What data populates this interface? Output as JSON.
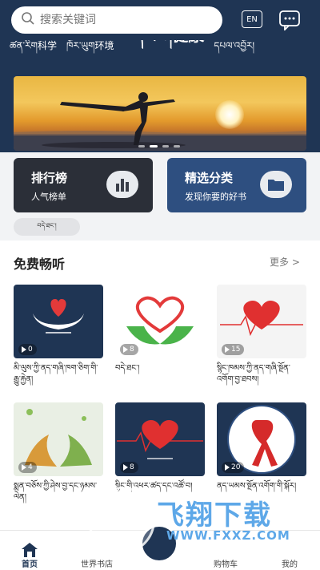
{
  "search": {
    "placeholder": "搜索关键词"
  },
  "header": {
    "lang_label": "EN"
  },
  "tabs": [
    {
      "label": "ཚན་རིག科学"
    },
    {
      "label": "ཁོར་ཡུག环境"
    },
    {
      "label": "བདེ་ཐང་།健康"
    },
    {
      "label": "དཔལ་འབྱོར།"
    }
  ],
  "cards": {
    "rank": {
      "title": "排行榜",
      "subtitle": "人气榜单"
    },
    "category": {
      "title": "精选分类",
      "subtitle": "发现你要的好书"
    }
  },
  "chip": {
    "label": "བདེ་ཐང་།"
  },
  "free_listen": {
    "title": "免费畅听",
    "more": "更多 >",
    "items": [
      {
        "count": "0",
        "caption": "མི་ལུས་ཀྱི་ནད་གཞི་ཁག་ཅིག་གི་རྒྱུ་རྐྱེན།"
      },
      {
        "count": "8",
        "caption": "བདེ་ཐང་།"
      },
      {
        "count": "15",
        "caption": "སྙིང་ཁམས་ཀྱི་ནད་གཞི་སྔོན་འགོག་བྱ་ཐབས།"
      },
      {
        "count": "4",
        "caption": "སྨན་བཅོས་ཀྱི་ཤེས་བྱ་དང་ཉམས་ལེན།"
      },
      {
        "count": "8",
        "caption": "སྙིང་གི་འཕར་ཚད་དང་འཚོ་བ།"
      },
      {
        "count": "20",
        "caption": "ནད་ཡམས་སྔོན་འགོག་གི་སྐོར།"
      }
    ]
  },
  "nav": {
    "home": "首页",
    "store": "世界书店",
    "cart": "购物车",
    "mine": "我的"
  },
  "watermark": {
    "brand": "飞翔下载",
    "url": "WWW.FXXZ.COM"
  },
  "colors": {
    "header_bg": "#1f3554",
    "card_dark": "#2b2f38",
    "card_blue": "#2e4f80",
    "watermark": "#5ea8e8"
  }
}
